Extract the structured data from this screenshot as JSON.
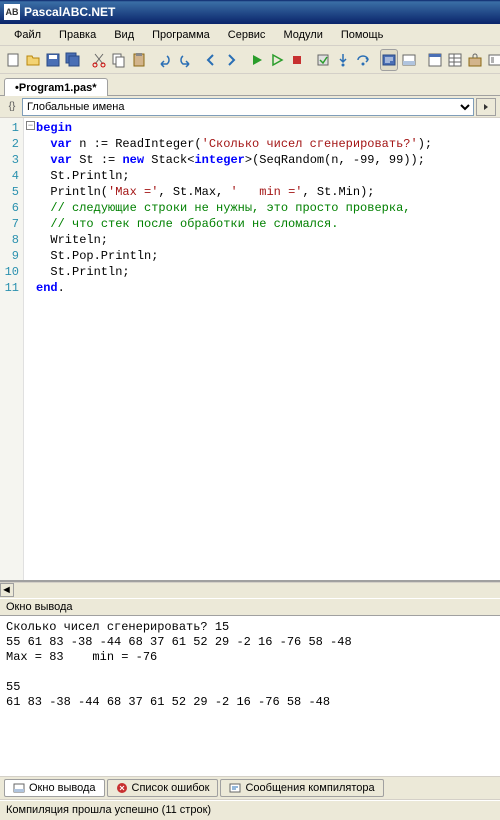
{
  "title": "PascalABC.NET",
  "menu": {
    "file": "Файл",
    "edit": "Правка",
    "view": "Вид",
    "program": "Программа",
    "service": "Сервис",
    "modules": "Модули",
    "help": "Помощь"
  },
  "tab": {
    "name": "•Program1.pas*"
  },
  "scope": {
    "label": "Глобальные имена"
  },
  "code": {
    "lines": [
      {
        "n": 1,
        "tokens": [
          {
            "t": "begin",
            "c": "kw"
          }
        ]
      },
      {
        "n": 2,
        "tokens": [
          {
            "t": "  ",
            "c": ""
          },
          {
            "t": "var",
            "c": "kw"
          },
          {
            "t": " n := ReadInteger(",
            "c": ""
          },
          {
            "t": "'Сколько чисел сгенерировать?'",
            "c": "str"
          },
          {
            "t": ");",
            "c": ""
          }
        ]
      },
      {
        "n": 3,
        "tokens": [
          {
            "t": "  ",
            "c": ""
          },
          {
            "t": "var",
            "c": "kw"
          },
          {
            "t": " St := ",
            "c": ""
          },
          {
            "t": "new",
            "c": "kw"
          },
          {
            "t": " Stack<",
            "c": ""
          },
          {
            "t": "integer",
            "c": "kw"
          },
          {
            "t": ">(SeqRandom(n, -99, 99));",
            "c": ""
          }
        ]
      },
      {
        "n": 4,
        "tokens": [
          {
            "t": "  St.Println;",
            "c": ""
          }
        ]
      },
      {
        "n": 5,
        "tokens": [
          {
            "t": "  Println(",
            "c": ""
          },
          {
            "t": "'Max ='",
            "c": "str"
          },
          {
            "t": ", St.Max, ",
            "c": ""
          },
          {
            "t": "'   min ='",
            "c": "str"
          },
          {
            "t": ", St.Min);",
            "c": ""
          }
        ]
      },
      {
        "n": 6,
        "tokens": [
          {
            "t": "  ",
            "c": ""
          },
          {
            "t": "// следующие строки не нужны, это просто проверка,",
            "c": "cmt"
          }
        ]
      },
      {
        "n": 7,
        "tokens": [
          {
            "t": "  ",
            "c": ""
          },
          {
            "t": "// что стек после обработки не сломался.",
            "c": "cmt"
          }
        ]
      },
      {
        "n": 8,
        "tokens": [
          {
            "t": "  Writeln;",
            "c": ""
          }
        ]
      },
      {
        "n": 9,
        "tokens": [
          {
            "t": "  St.Pop.Println;",
            "c": ""
          }
        ]
      },
      {
        "n": 10,
        "tokens": [
          {
            "t": "  St.Println;",
            "c": ""
          }
        ]
      },
      {
        "n": 11,
        "tokens": [
          {
            "t": "end",
            "c": "kw"
          },
          {
            "t": ".",
            "c": ""
          }
        ]
      }
    ]
  },
  "output": {
    "header": "Окно вывода",
    "text": "Сколько чисел сгенерировать? 15\n55 61 83 -38 -44 68 37 61 52 29 -2 16 -76 58 -48\nMax = 83    min = -76\n\n55\n61 83 -38 -44 68 37 61 52 29 -2 16 -76 58 -48"
  },
  "bottom_tabs": {
    "output": "Окно вывода",
    "errors": "Список ошибок",
    "compiler": "Сообщения компилятора"
  },
  "status": "Компиляция прошла успешно (11 строк)"
}
